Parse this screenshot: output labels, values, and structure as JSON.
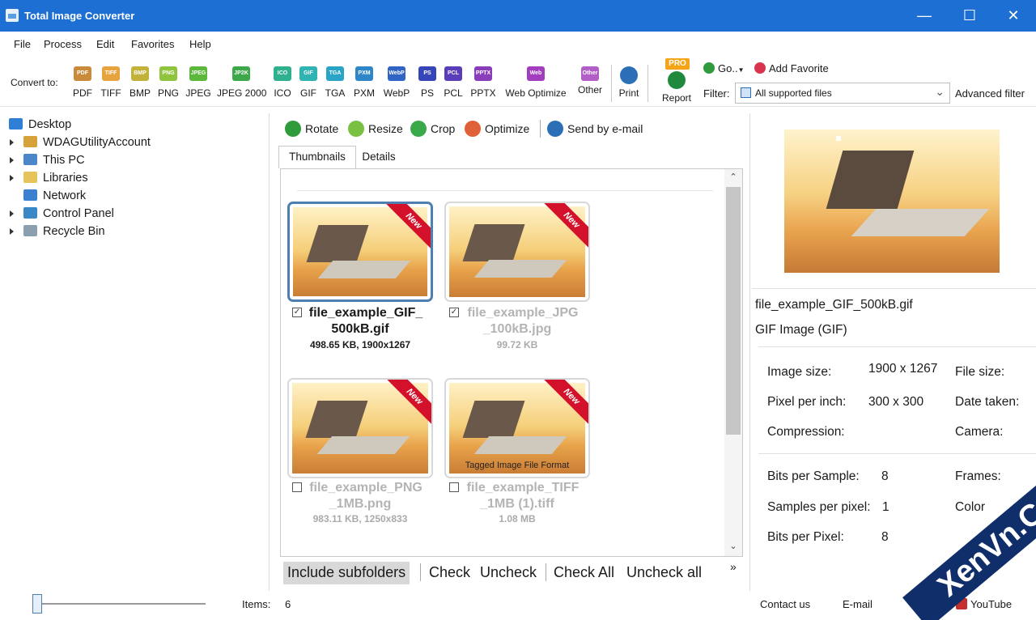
{
  "window": {
    "title": "Total Image Converter",
    "minimize_icon": "minimize-icon",
    "maximize_icon": "maximize-icon",
    "close_icon": "close-icon"
  },
  "menu": [
    "File",
    "Process",
    "Edit",
    "Favorites",
    "Help"
  ],
  "toolbar": {
    "convert_label": "Convert to:",
    "formats": [
      {
        "label": "PDF",
        "icon": "PDF",
        "color": "#c98a3a"
      },
      {
        "label": "TIFF",
        "icon": "TIFF",
        "color": "#e6a33e"
      },
      {
        "label": "BMP",
        "icon": "BMP",
        "color": "#c2b23a"
      },
      {
        "label": "PNG",
        "icon": "PNG",
        "color": "#8fc43d"
      },
      {
        "label": "JPEG",
        "icon": "JPEG",
        "color": "#5cb83a"
      },
      {
        "label": "JPEG 2000",
        "icon": "JP2K",
        "color": "#3da84a"
      },
      {
        "label": "ICO",
        "icon": "ICO",
        "color": "#2fb08e"
      },
      {
        "label": "GIF",
        "icon": "GIF",
        "color": "#2fb3b3"
      },
      {
        "label": "TGA",
        "icon": "TGA",
        "color": "#2aa4c6"
      },
      {
        "label": "PXM",
        "icon": "PXM",
        "color": "#2e86c9"
      },
      {
        "label": "WebP",
        "icon": "WebP",
        "color": "#2f63c4"
      },
      {
        "label": "PS",
        "icon": "PS",
        "color": "#3645b8"
      },
      {
        "label": "PCL",
        "icon": "PCL",
        "color": "#5a3db8"
      },
      {
        "label": "PPTX",
        "icon": "PPTX",
        "color": "#8a3dba"
      },
      {
        "label": "Web Optimize",
        "icon": "Web",
        "color": "#a23dbf"
      },
      {
        "label": "Other",
        "icon": "Other",
        "color": "#b35ec7"
      }
    ],
    "print_label": "Print",
    "report_label": "Report",
    "pro_badge": "PRO",
    "go_label": "Go..",
    "add_favorite_label": "Add Favorite",
    "filter_label": "Filter:",
    "filter_value": "All supported files",
    "advanced_filter_label": "Advanced filter"
  },
  "tree": [
    {
      "label": "Desktop",
      "icon": "desktop-icon",
      "color": "#2f7fd6"
    },
    {
      "label": "WDAGUtilityAccount",
      "icon": "user-icon",
      "color": "#d8a23a"
    },
    {
      "label": "This PC",
      "icon": "computer-icon",
      "color": "#4a86c9"
    },
    {
      "label": "Libraries",
      "icon": "folder-icon",
      "color": "#e6c45a"
    },
    {
      "label": "Network",
      "icon": "network-icon",
      "color": "#3a7fd0"
    },
    {
      "label": "Control Panel",
      "icon": "control-panel-icon",
      "color": "#3a88c6"
    },
    {
      "label": "Recycle Bin",
      "icon": "recycle-bin-icon",
      "color": "#8aa0b0"
    }
  ],
  "actions": [
    {
      "label": "Rotate",
      "icon": "rotate-icon",
      "color": "#2f9b3a"
    },
    {
      "label": "Resize",
      "icon": "resize-icon",
      "color": "#7ac143"
    },
    {
      "label": "Crop",
      "icon": "crop-icon",
      "color": "#3aa94a"
    },
    {
      "label": "Optimize",
      "icon": "optimize-icon",
      "color": "#e0603a"
    },
    {
      "label": "Send by e-mail",
      "icon": "email-icon",
      "color": "#2c6fb7"
    }
  ],
  "tabs": [
    "Thumbnails",
    "Details"
  ],
  "thumbnails": [
    {
      "name_line1": "file_example_GIF_",
      "name_line2": "500kB.gif",
      "size": "498.65 KB, 1900x1267",
      "checked": true,
      "selected": true,
      "badge": "New",
      "caption": ""
    },
    {
      "name_line1": "file_example_JPG",
      "name_line2": "_100kB.jpg",
      "size": "99.72 KB",
      "checked": true,
      "selected": false,
      "badge": "New",
      "caption": ""
    },
    {
      "name_line1": "file_example_PNG",
      "name_line2": "_1MB.png",
      "size": "983.11 KB, 1250x833",
      "checked": false,
      "selected": false,
      "badge": "New",
      "caption": ""
    },
    {
      "name_line1": "file_example_TIFF",
      "name_line2": "_1MB (1).tiff",
      "size": "1.08 MB",
      "checked": false,
      "selected": false,
      "badge": "New",
      "caption": "Tagged Image File Format"
    }
  ],
  "checkbar": {
    "include_subfolders": "Include subfolders",
    "check": "Check",
    "uncheck": "Uncheck",
    "check_all": "Check All",
    "uncheck_all": "Uncheck all",
    "more": "»"
  },
  "preview": {
    "filename": "file_example_GIF_500kB.gif",
    "type": "GIF Image (GIF)",
    "image_size_label": "Image size:",
    "image_size_value": "1900 x 1267",
    "file_size_label": "File size:",
    "ppi_label": "Pixel per inch:",
    "ppi_value": "300 x 300",
    "date_taken_label": "Date taken:",
    "compression_label": "Compression:",
    "camera_label": "Camera:",
    "bits_per_sample_label": "Bits per Sample:",
    "bits_per_sample_value": "8",
    "frames_label": "Frames:",
    "samples_per_pixel_label": "Samples per pixel:",
    "samples_per_pixel_value": "1",
    "color_label": "Color",
    "bits_per_pixel_label": "Bits per Pixel:",
    "bits_per_pixel_value": "8"
  },
  "status": {
    "items_label": "Items:",
    "items_value": "6",
    "contact": "Contact us",
    "email": "E-mail",
    "facebook_fragment": "ok",
    "youtube": "YouTube"
  },
  "watermark": "XenVn.Com"
}
